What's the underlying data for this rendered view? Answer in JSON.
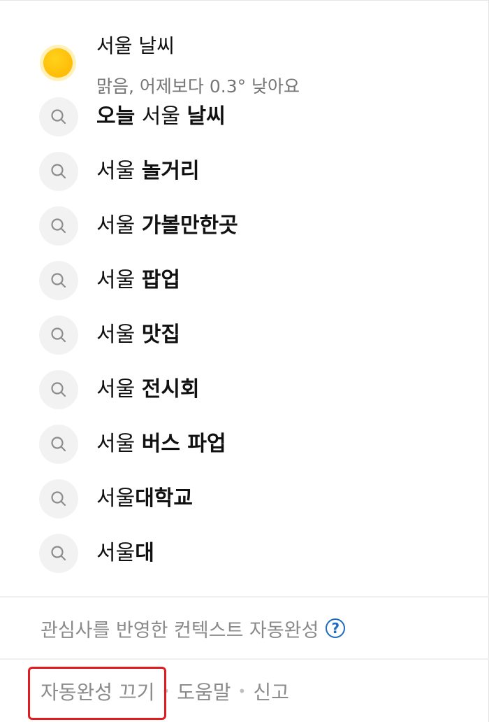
{
  "weather": {
    "title": "서울 날씨",
    "description": "맑음, 어제보다 0.3° 낮아요"
  },
  "suggestions": [
    {
      "plain": "",
      "bold": "오늘",
      "plain2": " 서울 ",
      "bold2": "날씨"
    },
    {
      "plain": "서울 ",
      "bold": "놀거리"
    },
    {
      "plain": "서울 ",
      "bold": "가볼만한곳"
    },
    {
      "plain": "서울 ",
      "bold": "팝업"
    },
    {
      "plain": "서울 ",
      "bold": "맛집"
    },
    {
      "plain": "서울 ",
      "bold": "전시회"
    },
    {
      "plain": "서울 ",
      "bold": "버스 파업"
    },
    {
      "plain": "서울",
      "bold": "대학교"
    },
    {
      "plain": "서울",
      "bold": "대"
    }
  ],
  "context": {
    "label": "관심사를 반영한 컨텍스트 자동완성",
    "help": "?"
  },
  "footer": {
    "autocomplete_off": "자동완성 끄기",
    "help": "도움말",
    "report": "신고",
    "separator": "•"
  },
  "colors": {
    "accent": "#1e6bc2",
    "highlight": "#e21c1c",
    "sun": "#ffc107"
  }
}
